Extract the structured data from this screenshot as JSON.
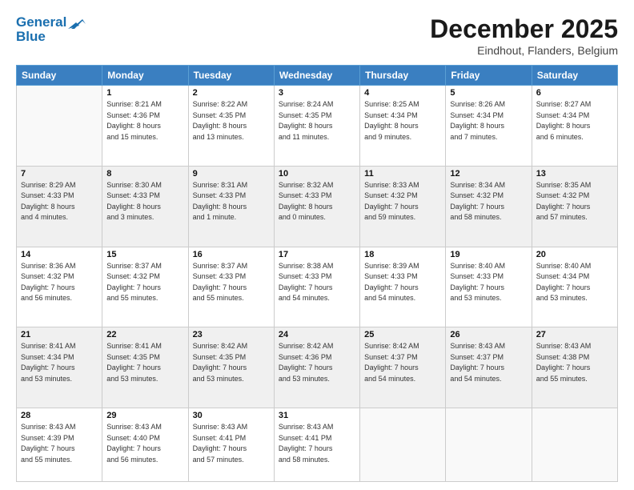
{
  "header": {
    "logo_line1": "General",
    "logo_line2": "Blue",
    "month_title": "December 2025",
    "location": "Eindhout, Flanders, Belgium"
  },
  "days_of_week": [
    "Sunday",
    "Monday",
    "Tuesday",
    "Wednesday",
    "Thursday",
    "Friday",
    "Saturday"
  ],
  "weeks": [
    [
      {
        "day": "",
        "detail": ""
      },
      {
        "day": "1",
        "detail": "Sunrise: 8:21 AM\nSunset: 4:36 PM\nDaylight: 8 hours\nand 15 minutes."
      },
      {
        "day": "2",
        "detail": "Sunrise: 8:22 AM\nSunset: 4:35 PM\nDaylight: 8 hours\nand 13 minutes."
      },
      {
        "day": "3",
        "detail": "Sunrise: 8:24 AM\nSunset: 4:35 PM\nDaylight: 8 hours\nand 11 minutes."
      },
      {
        "day": "4",
        "detail": "Sunrise: 8:25 AM\nSunset: 4:34 PM\nDaylight: 8 hours\nand 9 minutes."
      },
      {
        "day": "5",
        "detail": "Sunrise: 8:26 AM\nSunset: 4:34 PM\nDaylight: 8 hours\nand 7 minutes."
      },
      {
        "day": "6",
        "detail": "Sunrise: 8:27 AM\nSunset: 4:34 PM\nDaylight: 8 hours\nand 6 minutes."
      }
    ],
    [
      {
        "day": "7",
        "detail": "Sunrise: 8:29 AM\nSunset: 4:33 PM\nDaylight: 8 hours\nand 4 minutes."
      },
      {
        "day": "8",
        "detail": "Sunrise: 8:30 AM\nSunset: 4:33 PM\nDaylight: 8 hours\nand 3 minutes."
      },
      {
        "day": "9",
        "detail": "Sunrise: 8:31 AM\nSunset: 4:33 PM\nDaylight: 8 hours\nand 1 minute."
      },
      {
        "day": "10",
        "detail": "Sunrise: 8:32 AM\nSunset: 4:33 PM\nDaylight: 8 hours\nand 0 minutes."
      },
      {
        "day": "11",
        "detail": "Sunrise: 8:33 AM\nSunset: 4:32 PM\nDaylight: 7 hours\nand 59 minutes."
      },
      {
        "day": "12",
        "detail": "Sunrise: 8:34 AM\nSunset: 4:32 PM\nDaylight: 7 hours\nand 58 minutes."
      },
      {
        "day": "13",
        "detail": "Sunrise: 8:35 AM\nSunset: 4:32 PM\nDaylight: 7 hours\nand 57 minutes."
      }
    ],
    [
      {
        "day": "14",
        "detail": "Sunrise: 8:36 AM\nSunset: 4:32 PM\nDaylight: 7 hours\nand 56 minutes."
      },
      {
        "day": "15",
        "detail": "Sunrise: 8:37 AM\nSunset: 4:32 PM\nDaylight: 7 hours\nand 55 minutes."
      },
      {
        "day": "16",
        "detail": "Sunrise: 8:37 AM\nSunset: 4:33 PM\nDaylight: 7 hours\nand 55 minutes."
      },
      {
        "day": "17",
        "detail": "Sunrise: 8:38 AM\nSunset: 4:33 PM\nDaylight: 7 hours\nand 54 minutes."
      },
      {
        "day": "18",
        "detail": "Sunrise: 8:39 AM\nSunset: 4:33 PM\nDaylight: 7 hours\nand 54 minutes."
      },
      {
        "day": "19",
        "detail": "Sunrise: 8:40 AM\nSunset: 4:33 PM\nDaylight: 7 hours\nand 53 minutes."
      },
      {
        "day": "20",
        "detail": "Sunrise: 8:40 AM\nSunset: 4:34 PM\nDaylight: 7 hours\nand 53 minutes."
      }
    ],
    [
      {
        "day": "21",
        "detail": "Sunrise: 8:41 AM\nSunset: 4:34 PM\nDaylight: 7 hours\nand 53 minutes."
      },
      {
        "day": "22",
        "detail": "Sunrise: 8:41 AM\nSunset: 4:35 PM\nDaylight: 7 hours\nand 53 minutes."
      },
      {
        "day": "23",
        "detail": "Sunrise: 8:42 AM\nSunset: 4:35 PM\nDaylight: 7 hours\nand 53 minutes."
      },
      {
        "day": "24",
        "detail": "Sunrise: 8:42 AM\nSunset: 4:36 PM\nDaylight: 7 hours\nand 53 minutes."
      },
      {
        "day": "25",
        "detail": "Sunrise: 8:42 AM\nSunset: 4:37 PM\nDaylight: 7 hours\nand 54 minutes."
      },
      {
        "day": "26",
        "detail": "Sunrise: 8:43 AM\nSunset: 4:37 PM\nDaylight: 7 hours\nand 54 minutes."
      },
      {
        "day": "27",
        "detail": "Sunrise: 8:43 AM\nSunset: 4:38 PM\nDaylight: 7 hours\nand 55 minutes."
      }
    ],
    [
      {
        "day": "28",
        "detail": "Sunrise: 8:43 AM\nSunset: 4:39 PM\nDaylight: 7 hours\nand 55 minutes."
      },
      {
        "day": "29",
        "detail": "Sunrise: 8:43 AM\nSunset: 4:40 PM\nDaylight: 7 hours\nand 56 minutes."
      },
      {
        "day": "30",
        "detail": "Sunrise: 8:43 AM\nSunset: 4:41 PM\nDaylight: 7 hours\nand 57 minutes."
      },
      {
        "day": "31",
        "detail": "Sunrise: 8:43 AM\nSunset: 4:41 PM\nDaylight: 7 hours\nand 58 minutes."
      },
      {
        "day": "",
        "detail": ""
      },
      {
        "day": "",
        "detail": ""
      },
      {
        "day": "",
        "detail": ""
      }
    ]
  ]
}
